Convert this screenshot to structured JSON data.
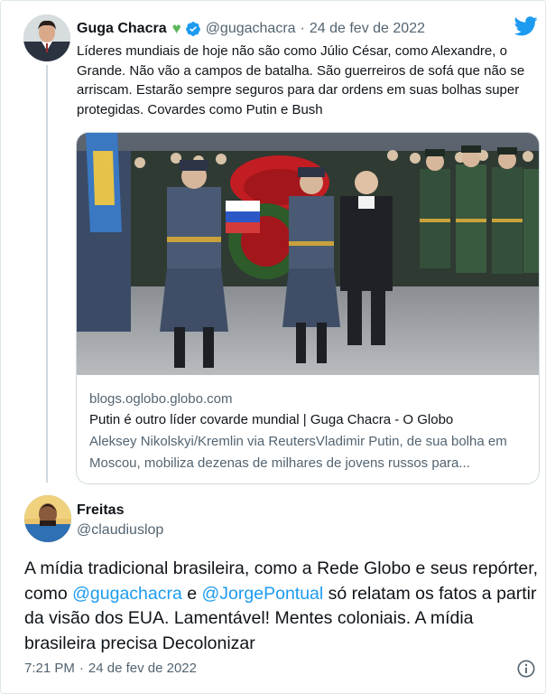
{
  "quoted_tweet": {
    "author_name": "Guga Chacra",
    "handle": "@gugachacra",
    "date": "24 de fev de 2022",
    "text": "Líderes mundiais de hoje não são como Júlio César, como Alexandre, o Grande. Não vão a campos de batalha. São guerreiros de sofá que não se arriscam. Estarão sempre seguros para dar ordens em suas bolhas super protegidas. Covardes como Putin e Bush",
    "icons": {
      "heart": "green-heart-icon",
      "verified": "verified-badge-icon",
      "brand": "twitter-bird-icon"
    },
    "link_card": {
      "domain": "blogs.oglobo.globo.com",
      "title": "Putin é outro líder covarde mundial | Guga Chacra - O Globo",
      "description": "Aleksey Nikolskyi/Kremlin via ReutersVladimir Putin, de sua bolha em Moscou, mobiliza dezenas de milhares de jovens russos para..."
    }
  },
  "main_tweet": {
    "author_name": "Freitas",
    "handle": "@claudiuslop",
    "text_parts": [
      "A mídia tradicional brasileira, como a Rede Globo e seus repórter, como ",
      "@gugachacra",
      " e ",
      "@JorgePontual",
      " só relatam os fatos a partir da visão dos EUA. Lamentável! Mentes coloniais. A mídia brasileira precisa Decolonizar"
    ],
    "time": "7:21 PM",
    "date": "24 de fev de 2022",
    "info_icon": "info-icon"
  },
  "colors": {
    "twitter_blue": "#1d9bf0",
    "secondary_text": "#536471",
    "heart_green": "#5db75a",
    "border": "#cfd9de"
  }
}
